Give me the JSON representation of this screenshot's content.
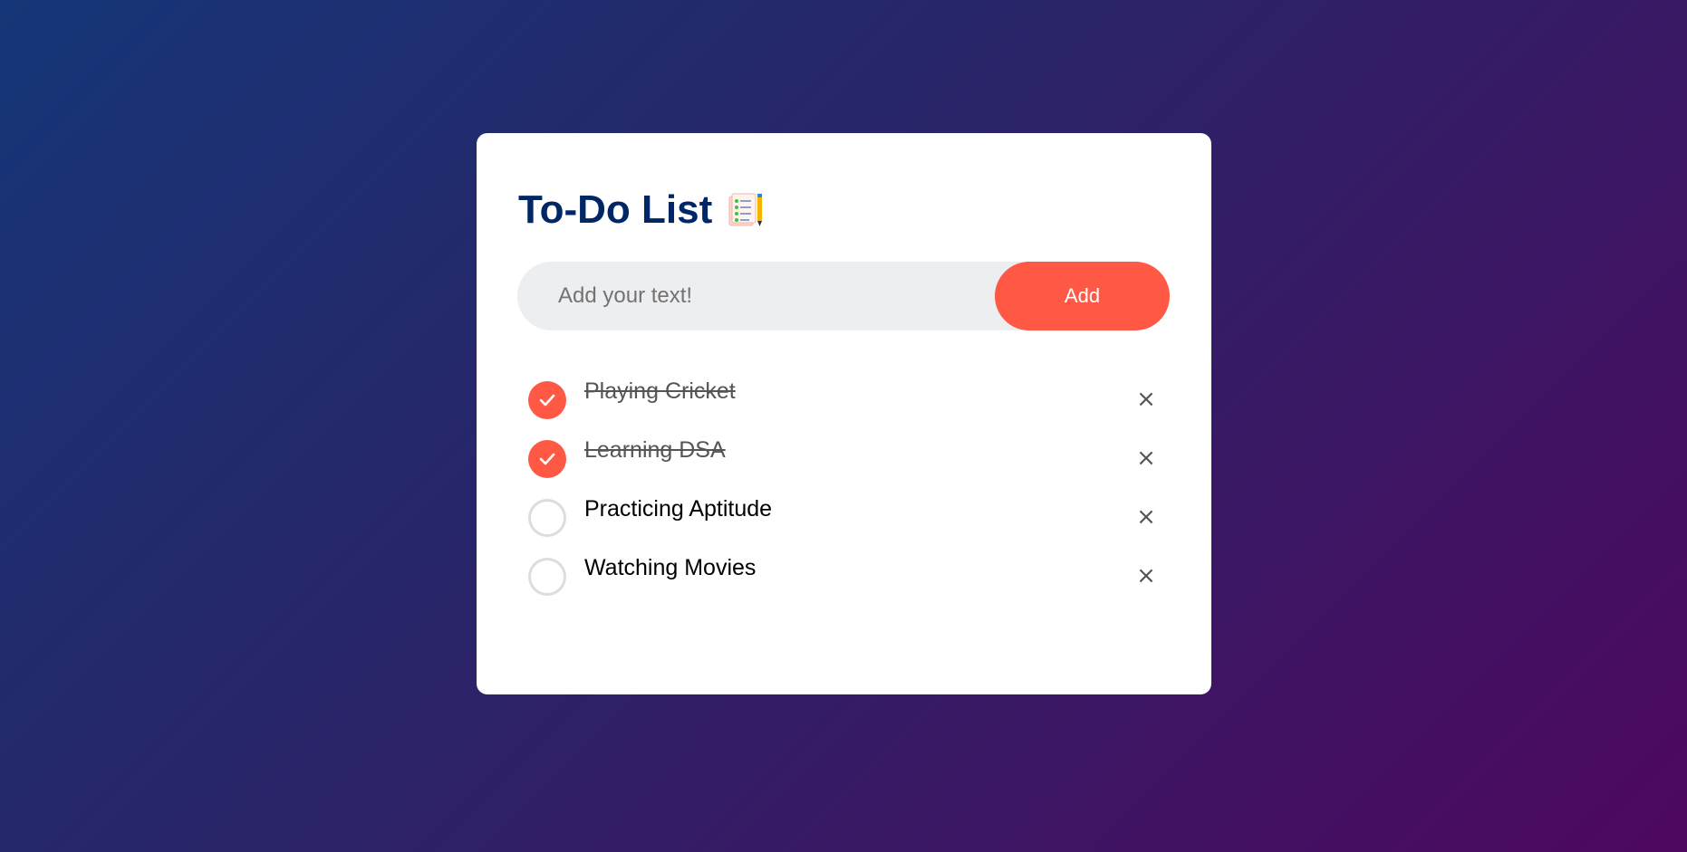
{
  "app": {
    "title": "To-Do List",
    "title_icon": "checklist-notepad-icon"
  },
  "input": {
    "placeholder": "Add your text!",
    "value": ""
  },
  "add_button": {
    "label": "Add"
  },
  "tasks": [
    {
      "text": "Playing Cricket",
      "checked": true
    },
    {
      "text": "Learning DSA",
      "checked": true
    },
    {
      "text": "Practicing Aptitude",
      "checked": false
    },
    {
      "text": "Watching Movies",
      "checked": false
    }
  ],
  "remove_glyph": "×",
  "colors": {
    "accent": "#ff5945",
    "title": "#002765",
    "input_bg": "#edeef0",
    "bg_start": "#153677",
    "bg_end": "#4e085f"
  }
}
